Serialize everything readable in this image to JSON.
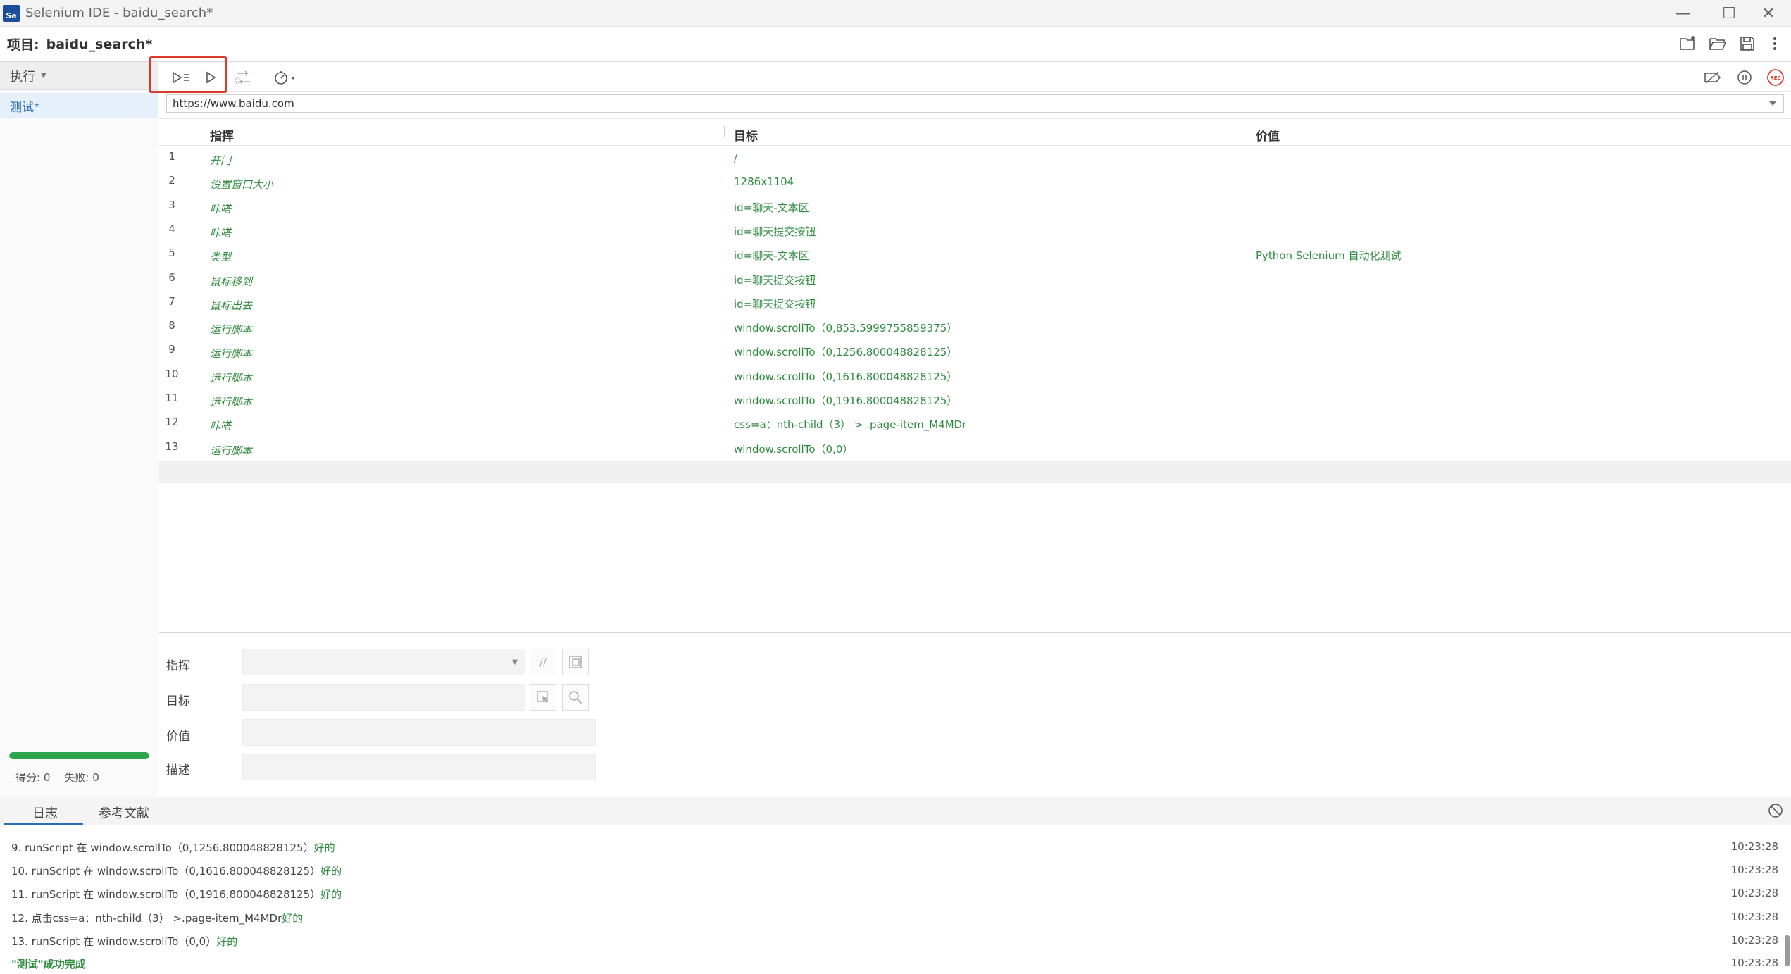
{
  "window": {
    "title": "Selenium IDE - baidu_search*",
    "logo_text": "Se",
    "controls": [
      "—",
      "☐",
      "✕"
    ]
  },
  "project": {
    "label": "项目:",
    "name": "baidu_search*"
  },
  "sidebar": {
    "dropdown_label": "执行",
    "tests": [
      {
        "label": "测试*"
      }
    ],
    "progress": 1.0,
    "stats": {
      "score_label": "得分: 0",
      "fail_label": "失败: 0"
    }
  },
  "url": "https://www.baidu.com",
  "grid": {
    "headers": {
      "command": "指挥",
      "target": "目标",
      "value": "价值"
    },
    "rows": [
      {
        "num": "1",
        "command": "开门",
        "target": "/",
        "value": ""
      },
      {
        "num": "2",
        "command": "设置窗口大小",
        "target": "1286x1104",
        "value": ""
      },
      {
        "num": "3",
        "command": "咔嗒",
        "target": "id=聊天-文本区",
        "value": ""
      },
      {
        "num": "4",
        "command": "咔嗒",
        "target": "id=聊天提交按钮",
        "value": ""
      },
      {
        "num": "5",
        "command": "类型",
        "target": "id=聊天-文本区",
        "value": "Python Selenium 自动化测试"
      },
      {
        "num": "6",
        "command": "鼠标移到",
        "target": "id=聊天提交按钮",
        "value": ""
      },
      {
        "num": "7",
        "command": "鼠标出去",
        "target": "id=聊天提交按钮",
        "value": ""
      },
      {
        "num": "8",
        "command": "运行脚本",
        "target": "window.scrollTo（0,853.5999755859375）",
        "value": ""
      },
      {
        "num": "9",
        "command": "运行脚本",
        "target": "window.scrollTo（0,1256.800048828125）",
        "value": ""
      },
      {
        "num": "10",
        "command": "运行脚本",
        "target": "window.scrollTo（0,1616.800048828125）",
        "value": ""
      },
      {
        "num": "11",
        "command": "运行脚本",
        "target": "window.scrollTo（0,1916.800048828125）",
        "value": ""
      },
      {
        "num": "12",
        "command": "咔嗒",
        "target": "css=a：nth-child（3） > .page-item_M4MDr",
        "value": ""
      },
      {
        "num": "13",
        "command": "运行脚本",
        "target": "window.scrollTo（0,0）",
        "value": ""
      }
    ]
  },
  "editor": {
    "command_label": "指挥",
    "target_label": "目标",
    "value_label": "价值",
    "description_label": "描述",
    "comment_button": "//"
  },
  "bottom": {
    "tabs": [
      "日志",
      "参考文献"
    ],
    "log": [
      {
        "msg": "9.  runScript 在 window.scrollTo（0,1256.800048828125）",
        "ok": "好的",
        "time": "10:23:28"
      },
      {
        "msg": "10. runScript 在 window.scrollTo（0,1616.800048828125）",
        "ok": "好的",
        "time": "10:23:28"
      },
      {
        "msg": "11. runScript 在 window.scrollTo（0,1916.800048828125）",
        "ok": "好的",
        "time": "10:23:28"
      },
      {
        "msg": "12. 点击css=a：nth-child（3） >.page-item_M4MDr",
        "ok": "好的",
        "time": "10:23:28"
      },
      {
        "msg": "13. runScript 在 window.scrollTo（0,0）",
        "ok": "好的",
        "time": "10:23:28"
      }
    ],
    "success": {
      "msg": "\"测试\"成功完成",
      "time": "10:23:28"
    }
  },
  "colors": {
    "accent": "#2a6ebb",
    "ok": "#2e8b3e",
    "highlight": "#d93a2b",
    "progress": "#2fa44f",
    "rec": "#d93a2b"
  },
  "icons": [
    "selenium-logo-icon",
    "new-project-icon",
    "open-folder-icon",
    "save-icon",
    "more-icon",
    "run-all-icon",
    "run-current-icon",
    "step-icon",
    "speed-icon",
    "disable-breakpoints-icon",
    "pause-icon",
    "record-icon",
    "select-target-icon",
    "find-target-icon",
    "clear-log-icon"
  ]
}
